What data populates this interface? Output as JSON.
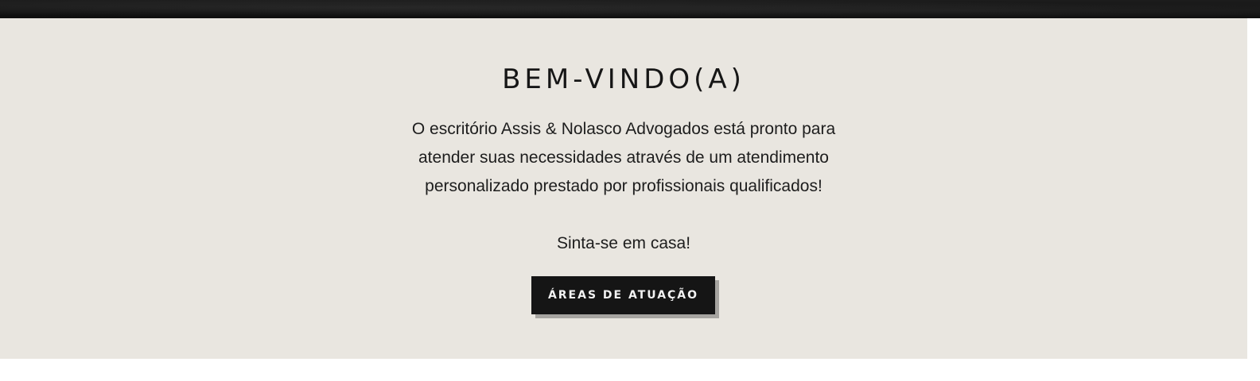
{
  "welcome": {
    "title": "BEM-VINDO(A)",
    "text": "O escritório Assis & Nolasco Advogados está pronto para atender suas necessidades através de um atendimento personalizado prestado por profissionais qualificados!",
    "tagline": "Sinta-se em casa!",
    "button_label": "ÁREAS DE ATUAÇÃO"
  },
  "colors": {
    "section_background": "#e9e6e0",
    "button_background": "#151515",
    "button_text": "#f2f2f2",
    "button_shadow": "#a6a4a0",
    "banner": "#111111"
  }
}
